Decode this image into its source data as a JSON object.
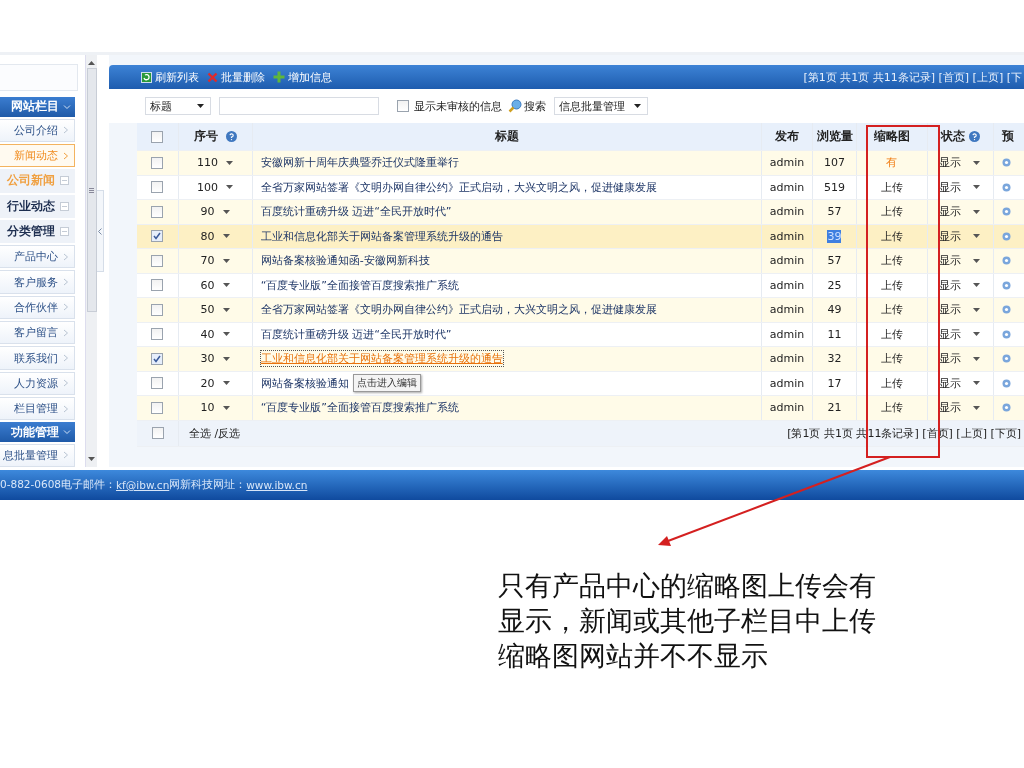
{
  "sidebar": {
    "groups": [
      {
        "title": "网站栏目",
        "expanded": true,
        "items": [
          {
            "kind": "link",
            "label": "公司介绍",
            "selected": false
          },
          {
            "kind": "link",
            "label": "新闻动态",
            "selected": true
          },
          {
            "kind": "node",
            "label": "公司新闻",
            "selected": true
          },
          {
            "kind": "node",
            "label": "行业动态",
            "selected": false
          },
          {
            "kind": "node",
            "label": "分类管理",
            "selected": false
          },
          {
            "kind": "link",
            "label": "产品中心",
            "selected": false
          },
          {
            "kind": "link",
            "label": "客户服务",
            "selected": false
          },
          {
            "kind": "link",
            "label": "合作伙伴",
            "selected": false
          },
          {
            "kind": "link",
            "label": "客户留言",
            "selected": false
          },
          {
            "kind": "link",
            "label": "联系我们",
            "selected": false
          },
          {
            "kind": "link",
            "label": "人力资源",
            "selected": false
          },
          {
            "kind": "link",
            "label": "栏目管理",
            "selected": false
          }
        ]
      },
      {
        "title": "功能管理",
        "expanded": true,
        "items": [
          {
            "kind": "link",
            "label": "息批量管理",
            "selected": false
          }
        ]
      }
    ]
  },
  "toolbar": {
    "actions": [
      {
        "kind": "refresh",
        "label": "刷新列表"
      },
      {
        "kind": "delete",
        "label": "批量删除"
      },
      {
        "kind": "add",
        "label": "增加信息"
      }
    ],
    "pagination": "[第1页 共1页 共11条记录] [首页] [上页] [下"
  },
  "filter": {
    "field_select": "标题",
    "unreviewed": {
      "label": "显示未审核的信息",
      "checked": false
    },
    "search_button": "搜索",
    "category_select": "信息批量管理"
  },
  "table": {
    "header_checked": false,
    "columns": [
      {
        "label": "序号",
        "help": true
      },
      {
        "label": "标题",
        "help": false
      },
      {
        "label": "发布",
        "help": false
      },
      {
        "label": "浏览量",
        "help": false
      },
      {
        "label": "缩略图",
        "help": false
      },
      {
        "label": "状态",
        "help": true
      },
      {
        "label": "预",
        "help": false
      }
    ],
    "rows": [
      {
        "checked": false,
        "highlighted": false,
        "hovered": false,
        "order": "110",
        "title": "安徽网新十周年庆典暨乔迁仪式隆重举行",
        "author": "admin",
        "views": "107",
        "views_selected": false,
        "thumbnail": "有",
        "has_thumbnail": true,
        "status": "显示"
      },
      {
        "checked": false,
        "highlighted": false,
        "hovered": false,
        "order": "100",
        "title": "全省万家网站签署《文明办网自律公约》正式启动，大兴文明之风，促进健康发展",
        "author": "admin",
        "views": "519",
        "views_selected": false,
        "thumbnail": "上传",
        "has_thumbnail": false,
        "status": "显示"
      },
      {
        "checked": false,
        "highlighted": false,
        "hovered": false,
        "order": "90",
        "title": "百度统计重磅升级 迈进“全民开放时代”",
        "author": "admin",
        "views": "57",
        "views_selected": false,
        "thumbnail": "上传",
        "has_thumbnail": false,
        "status": "显示"
      },
      {
        "checked": true,
        "highlighted": true,
        "hovered": false,
        "order": "80",
        "title": "工业和信息化部关于网站备案管理系统升级的通告",
        "author": "admin",
        "views": "39",
        "views_selected": true,
        "thumbnail": "上传",
        "has_thumbnail": false,
        "status": "显示"
      },
      {
        "checked": false,
        "highlighted": false,
        "hovered": false,
        "order": "70",
        "title": "网站备案核验通知函-安徽网新科技",
        "author": "admin",
        "views": "57",
        "views_selected": false,
        "thumbnail": "上传",
        "has_thumbnail": false,
        "status": "显示"
      },
      {
        "checked": false,
        "highlighted": false,
        "hovered": false,
        "order": "60",
        "title": "“百度专业版”全面接管百度搜索推广系统",
        "author": "admin",
        "views": "25",
        "views_selected": false,
        "thumbnail": "上传",
        "has_thumbnail": false,
        "status": "显示"
      },
      {
        "checked": false,
        "highlighted": false,
        "hovered": false,
        "order": "50",
        "title": "全省万家网站签署《文明办网自律公约》正式启动，大兴文明之风，促进健康发展",
        "author": "admin",
        "views": "49",
        "views_selected": false,
        "thumbnail": "上传",
        "has_thumbnail": false,
        "status": "显示"
      },
      {
        "checked": false,
        "highlighted": false,
        "hovered": false,
        "order": "40",
        "title": "百度统计重磅升级 迈进“全民开放时代”",
        "author": "admin",
        "views": "11",
        "views_selected": false,
        "thumbnail": "上传",
        "has_thumbnail": false,
        "status": "显示"
      },
      {
        "checked": true,
        "highlighted": false,
        "hovered": true,
        "order": "30",
        "title": "工业和信息化部关于网站备案管理系统升级的通告",
        "author": "admin",
        "views": "32",
        "views_selected": false,
        "thumbnail": "上传",
        "has_thumbnail": false,
        "status": "显示"
      },
      {
        "checked": false,
        "highlighted": false,
        "hovered": false,
        "order": "20",
        "title": "网站备案核验通知",
        "tooltip": "点击进入编辑",
        "author": "admin",
        "views": "17",
        "views_selected": false,
        "thumbnail": "上传",
        "has_thumbnail": false,
        "status": "显示"
      },
      {
        "checked": false,
        "highlighted": false,
        "hovered": false,
        "order": "10",
        "title": "“百度专业版”全面接管百度搜索推广系统",
        "author": "admin",
        "views": "21",
        "views_selected": false,
        "thumbnail": "上传",
        "has_thumbnail": false,
        "status": "显示"
      }
    ],
    "footer": {
      "checked": false,
      "select_all": "全选 /反选",
      "pagination": "[第1页 共1页 共11条记录] [首页] [上页] [下页]"
    }
  },
  "status_bar": {
    "phone_text": "0-882-0608电子邮件：",
    "email": "kf@ibw.cn",
    "site_label": "网新科技网址：",
    "site": "www.ibw.cn"
  },
  "annotation": {
    "text": "只有产品中心的缩略图上传会有显示，新闻或其他子栏目中上传缩略图网站并不不显示"
  }
}
